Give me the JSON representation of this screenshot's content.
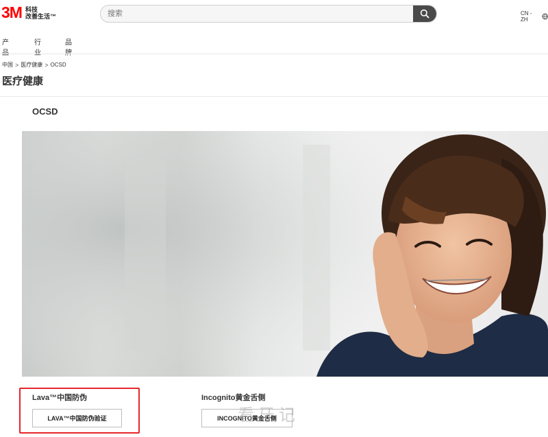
{
  "brand": {
    "logo_text": "3M",
    "tagline_line1": "科技",
    "tagline_line2": "改善生活™",
    "accent": "#ff0000"
  },
  "search": {
    "placeholder": "搜索",
    "button_icon": "search-icon"
  },
  "locale": {
    "label": "CN - ZH",
    "icon": "globe-icon"
  },
  "nav": {
    "items": [
      {
        "label": "产品"
      },
      {
        "label": "行业"
      },
      {
        "label": "品牌"
      }
    ]
  },
  "breadcrumb": {
    "items": [
      "中国",
      "医疗健康",
      "OCSD"
    ],
    "separator": ">"
  },
  "page": {
    "title": "医疗健康"
  },
  "section": {
    "title": "OCSD"
  },
  "hero": {
    "description": "hero-photo"
  },
  "cards": [
    {
      "title": "Lava™中国防伪",
      "button_label": "LAVA™中国防伪验证"
    },
    {
      "title": "Incognito黄金舌侧",
      "button_label": "INCOGNITO黄金舌侧"
    }
  ],
  "watermark": {
    "text": "看牙记"
  },
  "highlight": {
    "color": "#e5262b"
  }
}
